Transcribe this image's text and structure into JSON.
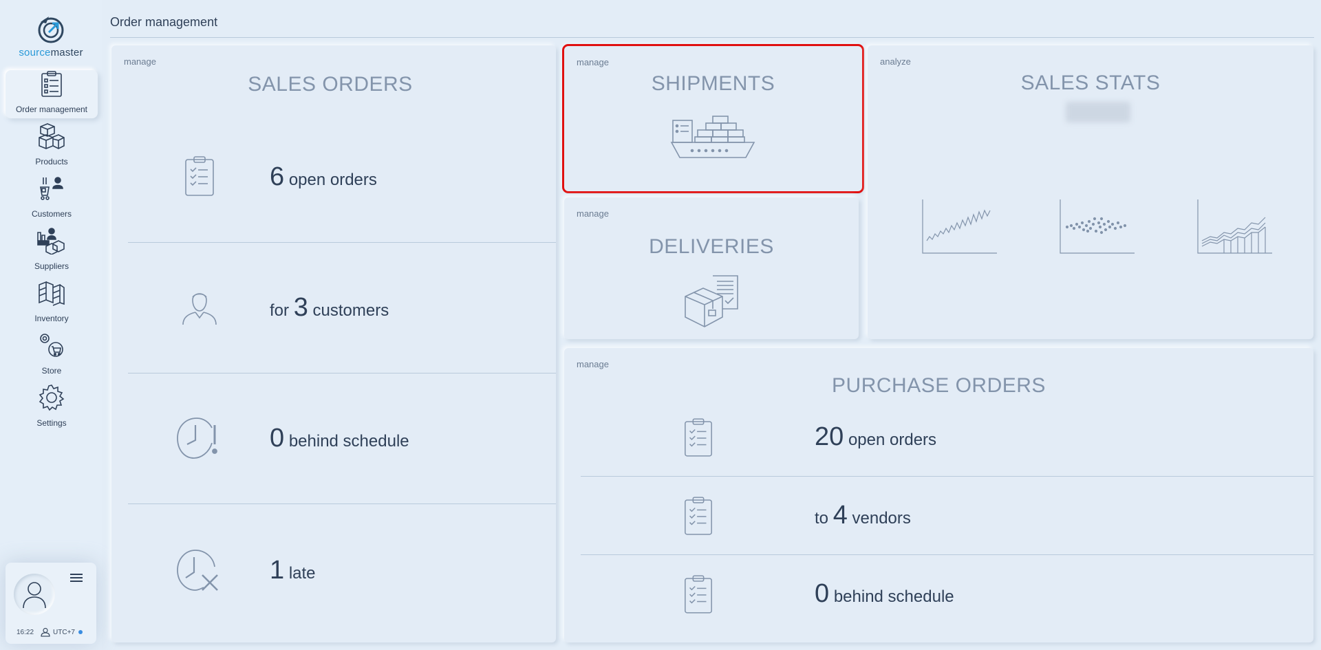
{
  "brand": {
    "part1": "source",
    "part2": "master"
  },
  "sidebar": {
    "items": [
      {
        "label": "Order management",
        "icon": "clipboard-icon",
        "active": true
      },
      {
        "label": "Products",
        "icon": "boxes-icon"
      },
      {
        "label": "Customers",
        "icon": "customers-icon"
      },
      {
        "label": "Suppliers",
        "icon": "suppliers-icon"
      },
      {
        "label": "Inventory",
        "icon": "inventory-icon"
      },
      {
        "label": "Store",
        "icon": "store-icon"
      },
      {
        "label": "Settings",
        "icon": "gear-icon"
      }
    ]
  },
  "user": {
    "time": "16:22",
    "timezone": "UTC+7"
  },
  "header": {
    "title": "Order management"
  },
  "sales_orders": {
    "tag": "manage",
    "title": "SALES ORDERS",
    "rows": [
      {
        "pre": "",
        "num": "6",
        "post": "open orders"
      },
      {
        "pre": "for",
        "num": "3",
        "post": "customers"
      },
      {
        "pre": "",
        "num": "0",
        "post": "behind schedule"
      },
      {
        "pre": "",
        "num": "1",
        "post": "late"
      }
    ]
  },
  "shipments": {
    "tag": "manage",
    "title": "SHIPMENTS"
  },
  "deliveries": {
    "tag": "manage",
    "title": "DELIVERIES"
  },
  "sales_stats": {
    "tag": "analyze",
    "title": "SALES STATS"
  },
  "purchase_orders": {
    "tag": "manage",
    "title": "PURCHASE ORDERS",
    "rows": [
      {
        "pre": "",
        "num": "20",
        "post": "open orders"
      },
      {
        "pre": "to",
        "num": "4",
        "post": "vendors"
      },
      {
        "pre": "",
        "num": "0",
        "post": "behind schedule"
      }
    ]
  },
  "colors": {
    "accent": "#2a9ad8",
    "highlight": "#e01010",
    "muted": "#8394ab"
  }
}
